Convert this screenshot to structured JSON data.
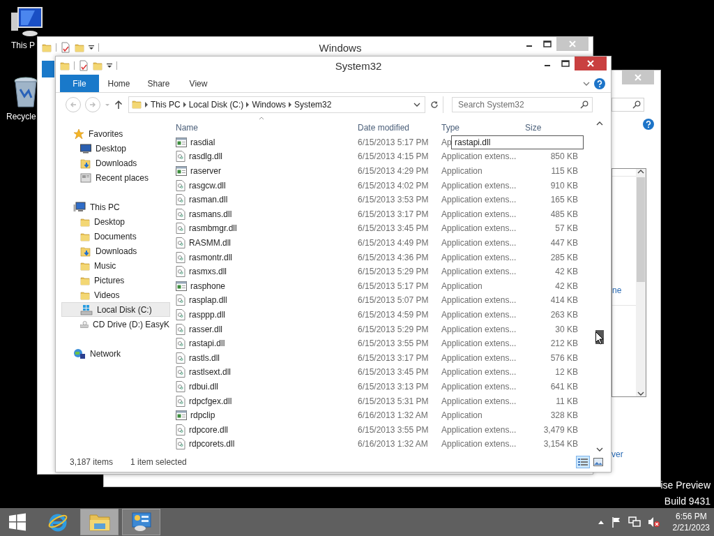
{
  "desktop": {
    "icons": [
      {
        "kind": "pc",
        "label": "This P"
      },
      {
        "kind": "recycle",
        "label": "Recycle"
      }
    ],
    "build_info": [
      "ise Preview",
      "Build 9431"
    ]
  },
  "back_window": {
    "links": [
      "ne",
      "ver"
    ]
  },
  "middle_window": {
    "title": "Windows"
  },
  "explorer": {
    "title": "System32",
    "ribbon_tabs": [
      {
        "label": "File",
        "kind": "file"
      },
      {
        "label": "Home",
        "kind": "tab"
      },
      {
        "label": "Share",
        "kind": "tab"
      },
      {
        "label": "View",
        "kind": "tab"
      }
    ],
    "breadcrumbs": [
      "This PC",
      "Local Disk (C:)",
      "Windows",
      "System32"
    ],
    "search": {
      "placeholder": "Search System32"
    },
    "nav": [
      {
        "label": "Favorites",
        "kind": "star",
        "selected": false,
        "children": [
          {
            "label": "Desktop",
            "kind": "desktop",
            "selected": false
          },
          {
            "label": "Downloads",
            "kind": "downloads",
            "selected": false
          },
          {
            "label": "Recent places",
            "kind": "recent",
            "selected": false
          }
        ]
      },
      {
        "label": "This PC",
        "kind": "pc",
        "selected": false,
        "children": [
          {
            "label": "Desktop",
            "kind": "folder",
            "selected": false
          },
          {
            "label": "Documents",
            "kind": "folder",
            "selected": false
          },
          {
            "label": "Downloads",
            "kind": "downloads",
            "selected": false
          },
          {
            "label": "Music",
            "kind": "folder",
            "selected": false
          },
          {
            "label": "Pictures",
            "kind": "folder",
            "selected": false
          },
          {
            "label": "Videos",
            "kind": "folder",
            "selected": false
          },
          {
            "label": "Local Disk (C:)",
            "kind": "disk",
            "selected": true
          },
          {
            "label": "CD Drive (D:) EasyK",
            "kind": "cd",
            "selected": false
          }
        ]
      },
      {
        "label": "Network",
        "kind": "network",
        "selected": false
      }
    ],
    "columns": [
      "Name",
      "Date modified",
      "Type",
      "Size"
    ],
    "rows": [
      {
        "kind": "app",
        "name": "rasdial",
        "date": "6/15/2013 5:17 PM",
        "type": "Ap",
        "rename_value": "rastapi.dll"
      },
      {
        "kind": "dll",
        "name": "rasdlg.dll",
        "date": "6/15/2013 4:15 PM",
        "type": "Application extens...",
        "size": "850 KB"
      },
      {
        "kind": "app",
        "name": "raserver",
        "date": "6/15/2013 4:29 PM",
        "type": "Application",
        "size": "115 KB"
      },
      {
        "kind": "dll",
        "name": "rasgcw.dll",
        "date": "6/15/2013 4:02 PM",
        "type": "Application extens...",
        "size": "910 KB"
      },
      {
        "kind": "dll",
        "name": "rasman.dll",
        "date": "6/15/2013 3:53 PM",
        "type": "Application extens...",
        "size": "165 KB"
      },
      {
        "kind": "dll",
        "name": "rasmans.dll",
        "date": "6/15/2013 3:17 PM",
        "type": "Application extens...",
        "size": "485 KB"
      },
      {
        "kind": "dll",
        "name": "rasmbmgr.dll",
        "date": "6/15/2013 3:45 PM",
        "type": "Application extens...",
        "size": "57 KB"
      },
      {
        "kind": "dll",
        "name": "RASMM.dll",
        "date": "6/15/2013 4:49 PM",
        "type": "Application extens...",
        "size": "447 KB"
      },
      {
        "kind": "dll",
        "name": "rasmontr.dll",
        "date": "6/15/2013 4:36 PM",
        "type": "Application extens...",
        "size": "285 KB"
      },
      {
        "kind": "dll",
        "name": "rasmxs.dll",
        "date": "6/15/2013 5:29 PM",
        "type": "Application extens...",
        "size": "42 KB"
      },
      {
        "kind": "app",
        "name": "rasphone",
        "date": "6/15/2013 5:17 PM",
        "type": "Application",
        "size": "42 KB"
      },
      {
        "kind": "dll",
        "name": "rasplap.dll",
        "date": "6/15/2013 5:07 PM",
        "type": "Application extens...",
        "size": "414 KB"
      },
      {
        "kind": "dll",
        "name": "rasppp.dll",
        "date": "6/15/2013 4:59 PM",
        "type": "Application extens...",
        "size": "263 KB"
      },
      {
        "kind": "dll",
        "name": "rasser.dll",
        "date": "6/15/2013 5:29 PM",
        "type": "Application extens...",
        "size": "30 KB"
      },
      {
        "kind": "dll",
        "name": "rastapi.dll",
        "date": "6/15/2013 3:55 PM",
        "type": "Application extens...",
        "size": "212 KB"
      },
      {
        "kind": "dll",
        "name": "rastls.dll",
        "date": "6/15/2013 3:17 PM",
        "type": "Application extens...",
        "size": "576 KB"
      },
      {
        "kind": "dll",
        "name": "rastlsext.dll",
        "date": "6/15/2013 3:45 PM",
        "type": "Application extens...",
        "size": "12 KB"
      },
      {
        "kind": "dll",
        "name": "rdbui.dll",
        "date": "6/15/2013 3:13 PM",
        "type": "Application extens...",
        "size": "641 KB"
      },
      {
        "kind": "dll",
        "name": "rdpcfgex.dll",
        "date": "6/15/2013 5:31 PM",
        "type": "Application extens...",
        "size": "11 KB"
      },
      {
        "kind": "app",
        "name": "rdpclip",
        "date": "6/16/2013 1:32 AM",
        "type": "Application",
        "size": "328 KB"
      },
      {
        "kind": "dll",
        "name": "rdpcore.dll",
        "date": "6/15/2013 3:55 PM",
        "type": "Application extens...",
        "size": "3,479 KB"
      },
      {
        "kind": "dll",
        "name": "rdpcorets.dll",
        "date": "6/16/2013 1:32 AM",
        "type": "Application extens...",
        "size": "3,154 KB"
      }
    ],
    "status": {
      "items": "3,187 items",
      "selection": "1 item selected"
    },
    "view_buttons": [
      {
        "kind": "details",
        "selected": true
      },
      {
        "kind": "tiles",
        "selected": false
      }
    ]
  },
  "taskbar": {
    "apps": [
      {
        "kind": "ie",
        "running": false,
        "active": false
      },
      {
        "kind": "explorer",
        "running": true,
        "active": true
      },
      {
        "kind": "control",
        "running": true,
        "active": false
      }
    ],
    "volume_muted": true,
    "clock": {
      "time": "6:56 PM",
      "date": "2/21/2023"
    }
  }
}
